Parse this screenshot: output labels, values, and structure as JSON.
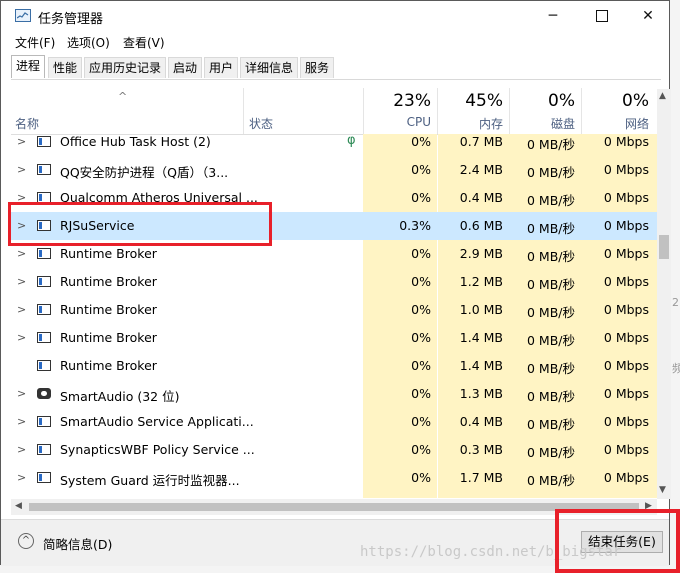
{
  "window": {
    "title": "任务管理器"
  },
  "menu": [
    "文件(F)",
    "选项(O)",
    "查看(V)"
  ],
  "tabs": [
    "进程",
    "性能",
    "应用历史记录",
    "启动",
    "用户",
    "详细信息",
    "服务"
  ],
  "header": {
    "name": "名称",
    "status": "状态",
    "cpu": {
      "pct": "23%",
      "label": "CPU"
    },
    "mem": {
      "pct": "45%",
      "label": "内存"
    },
    "disk": {
      "pct": "0%",
      "label": "磁盘"
    },
    "net": {
      "pct": "0%",
      "label": "网络"
    }
  },
  "rows": [
    {
      "name": "Office Hub Task Host (2)",
      "status": "φ",
      "cpu": "0%",
      "mem": "0.7 MB",
      "disk": "0 MB/秒",
      "net": "0 Mbps"
    },
    {
      "name": "QQ安全防护进程（Q盾）（3...",
      "status": "",
      "cpu": "0%",
      "mem": "2.4 MB",
      "disk": "0 MB/秒",
      "net": "0 Mbps"
    },
    {
      "name": "Qualcomm Atheros Universal ...",
      "status": "",
      "cpu": "0%",
      "mem": "0.4 MB",
      "disk": "0 MB/秒",
      "net": "0 Mbps"
    },
    {
      "name": "RJSuService",
      "status": "",
      "cpu": "0.3%",
      "mem": "0.6 MB",
      "disk": "0 MB/秒",
      "net": "0 Mbps"
    },
    {
      "name": "Runtime Broker",
      "status": "",
      "cpu": "0%",
      "mem": "2.9 MB",
      "disk": "0 MB/秒",
      "net": "0 Mbps"
    },
    {
      "name": "Runtime Broker",
      "status": "",
      "cpu": "0%",
      "mem": "1.2 MB",
      "disk": "0 MB/秒",
      "net": "0 Mbps"
    },
    {
      "name": "Runtime Broker",
      "status": "",
      "cpu": "0%",
      "mem": "1.0 MB",
      "disk": "0 MB/秒",
      "net": "0 Mbps"
    },
    {
      "name": "Runtime Broker",
      "status": "",
      "cpu": "0%",
      "mem": "1.4 MB",
      "disk": "0 MB/秒",
      "net": "0 Mbps"
    },
    {
      "name": "Runtime Broker",
      "status": "",
      "cpu": "0%",
      "mem": "1.4 MB",
      "disk": "0 MB/秒",
      "net": "0 Mbps"
    },
    {
      "name": "SmartAudio (32 位)",
      "status": "",
      "cpu": "0%",
      "mem": "1.3 MB",
      "disk": "0 MB/秒",
      "net": "0 Mbps"
    },
    {
      "name": "SmartAudio Service Applicati...",
      "status": "",
      "cpu": "0%",
      "mem": "0.4 MB",
      "disk": "0 MB/秒",
      "net": "0 Mbps"
    },
    {
      "name": "SynapticsWBF Policy Service ...",
      "status": "",
      "cpu": "0%",
      "mem": "0.3 MB",
      "disk": "0 MB/秒",
      "net": "0 Mbps"
    },
    {
      "name": "System Guard 运行时监视器...",
      "status": "",
      "cpu": "0%",
      "mem": "1.7 MB",
      "disk": "0 MB/秒",
      "net": "0 Mbps"
    }
  ],
  "footer": {
    "brief": "简略信息(D)",
    "end_task": "结束任务(E)"
  },
  "watermark": "https://blog.csdn.net/b_bigstar",
  "colors": {
    "highlight": "#e8202a",
    "selected_row": "#cce8ff",
    "usage_col": "#fff4c4"
  }
}
